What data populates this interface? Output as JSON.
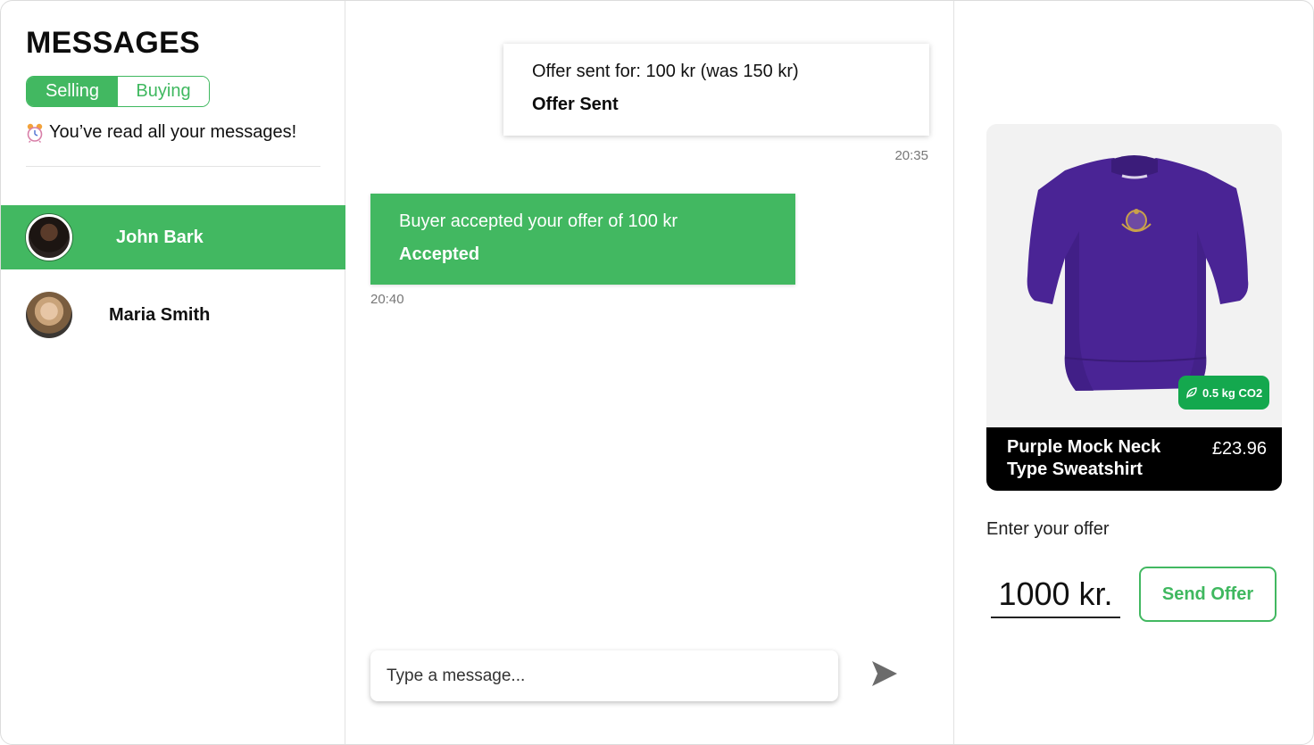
{
  "sidebar": {
    "title": "MESSAGES",
    "tabs": [
      {
        "label": "Selling",
        "active": true
      },
      {
        "label": "Buying",
        "active": false
      }
    ],
    "read_note": "You’ve read all your messages!",
    "read_note_icon": "alarm-clock-icon",
    "contacts": [
      {
        "name": "John Bark",
        "selected": true
      },
      {
        "name": "Maria Smith",
        "selected": false
      }
    ]
  },
  "chat": {
    "messages": [
      {
        "direction": "outgoing",
        "text": "Offer sent for: 100 kr (was 150 kr)",
        "status": "Offer Sent",
        "time": "20:35"
      },
      {
        "direction": "incoming",
        "text": "Buyer accepted your offer of 100 kr",
        "status": "Accepted",
        "time": "20:40"
      }
    ],
    "composer": {
      "placeholder": "Type a message...",
      "value": ""
    },
    "send_icon": "send-arrow-icon"
  },
  "product": {
    "title": "Purple Mock Neck Type Sweatshirt",
    "price": "£23.96",
    "co2_badge": "0.5 kg CO2",
    "badge_icon": "leaf-icon",
    "image_icon": "sweatshirt-image"
  },
  "offer": {
    "label": "Enter your offer",
    "value": "1000 kr.",
    "button_label": "Send Offer"
  },
  "colors": {
    "accent": "#42b861",
    "badge": "#14a84e",
    "product_card_footer": "#000000",
    "sweatshirt": "#4a2495"
  }
}
